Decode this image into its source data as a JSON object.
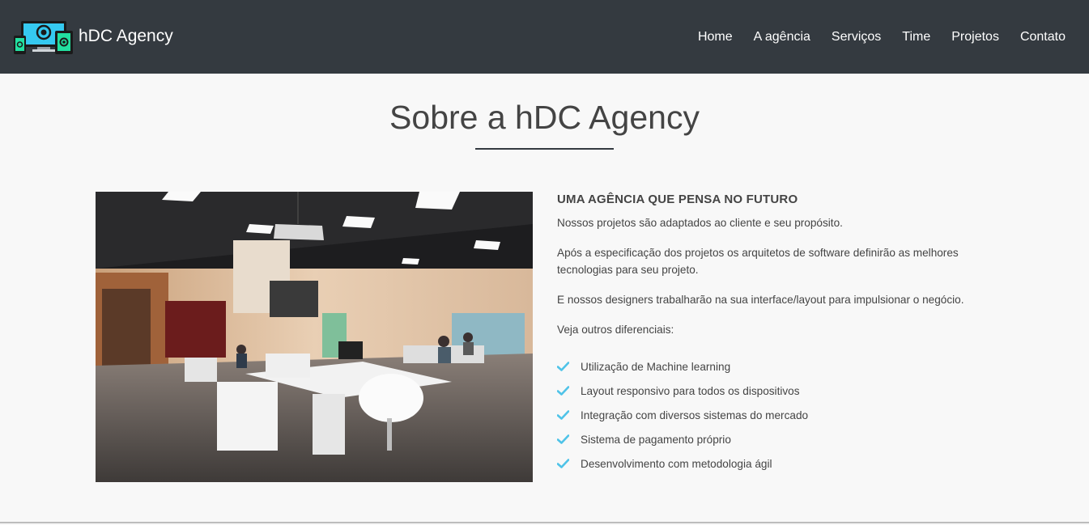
{
  "navbar": {
    "brand_name": "hDC Agency",
    "links": [
      "Home",
      "A agência",
      "Serviços",
      "Time",
      "Projetos",
      "Contato"
    ]
  },
  "about": {
    "title": "Sobre a hDC Agency",
    "heading": "UMA AGÊNCIA QUE PENSA NO FUTURO",
    "paragraphs": [
      "Nossos projetos são adaptados ao cliente e seu propósito.",
      "Após a especificação dos projetos os arquitetos de software definirão as melhores tecnologias para seu projeto.",
      "E nossos designers trabalharão na sua interface/layout para impulsionar o negócio.",
      "Veja outros diferenciais:"
    ],
    "features": [
      "Utilização de Machine learning",
      "Layout responsivo para todos os dispositivos",
      "Integração com diversos sistemas do mercado",
      "Sistema de pagamento próprio",
      "Desenvolvimento com metodologia ágil"
    ]
  },
  "colors": {
    "navbar_bg": "#343a40",
    "page_bg": "#f8f8f8",
    "accent_check": "#4fc3e8",
    "text": "#444444"
  },
  "icons": {
    "brand_logo": "devices-logo-icon",
    "feature_bullet": "check-icon"
  }
}
